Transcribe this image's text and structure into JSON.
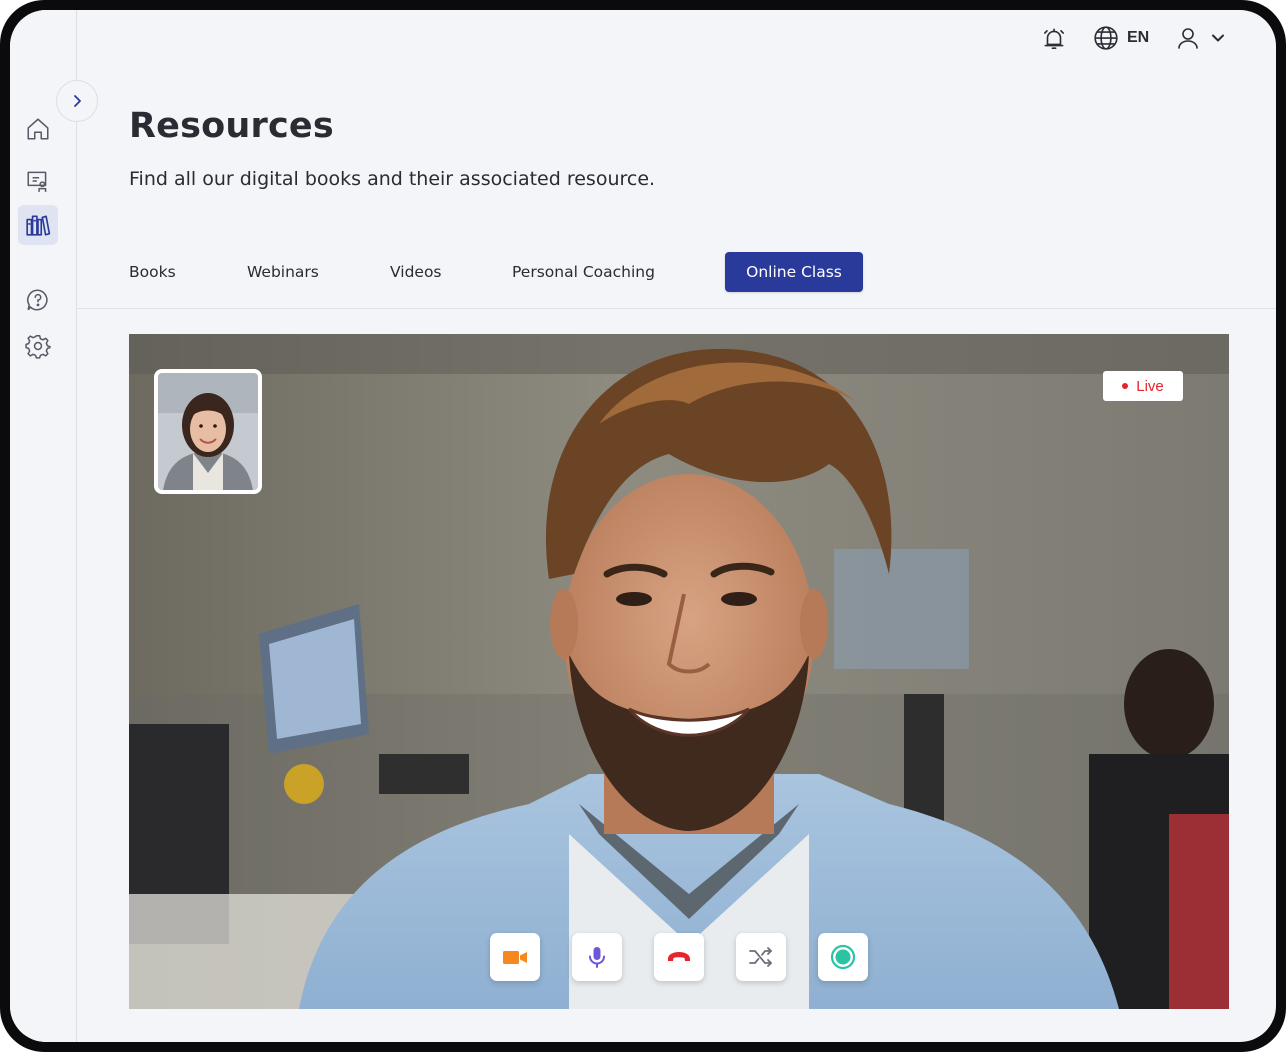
{
  "topbar": {
    "language": "EN",
    "icons": [
      "alarm-bell-icon",
      "globe-icon",
      "user-icon",
      "chevron-down-icon"
    ]
  },
  "sidebar": {
    "items": [
      {
        "name": "home",
        "icon": "home-icon",
        "active": false
      },
      {
        "name": "classroom",
        "icon": "presentation-icon",
        "active": false
      },
      {
        "name": "resources",
        "icon": "library-books-icon",
        "active": true
      },
      {
        "name": "help",
        "icon": "help-chat-icon",
        "active": false
      },
      {
        "name": "settings",
        "icon": "gear-icon",
        "active": false
      }
    ],
    "toggle_icon": "chevron-right-icon"
  },
  "page": {
    "title": "Resources",
    "subtitle": "Find all our digital books and their associated resource."
  },
  "tabs": [
    {
      "label": "Books",
      "active": false
    },
    {
      "label": "Webinars",
      "active": false
    },
    {
      "label": "Videos",
      "active": false
    },
    {
      "label": "Personal Coaching",
      "active": false
    },
    {
      "label": "Online Class",
      "active": true
    }
  ],
  "video_call": {
    "live_label": "Live",
    "controls": [
      {
        "name": "camera",
        "icon": "video-camera-icon",
        "color": "#f5891f"
      },
      {
        "name": "microphone",
        "icon": "microphone-icon",
        "color": "#6f56d9"
      },
      {
        "name": "end-call",
        "icon": "hang-up-icon",
        "color": "#e4252d"
      },
      {
        "name": "shuffle",
        "icon": "shuffle-icon",
        "color": "#6b6f7a"
      },
      {
        "name": "record",
        "icon": "record-icon",
        "color": "#2bc3a4"
      }
    ]
  },
  "colors": {
    "accent": "#2a3a9a",
    "background": "#f4f5f9",
    "live": "#e4252d"
  }
}
